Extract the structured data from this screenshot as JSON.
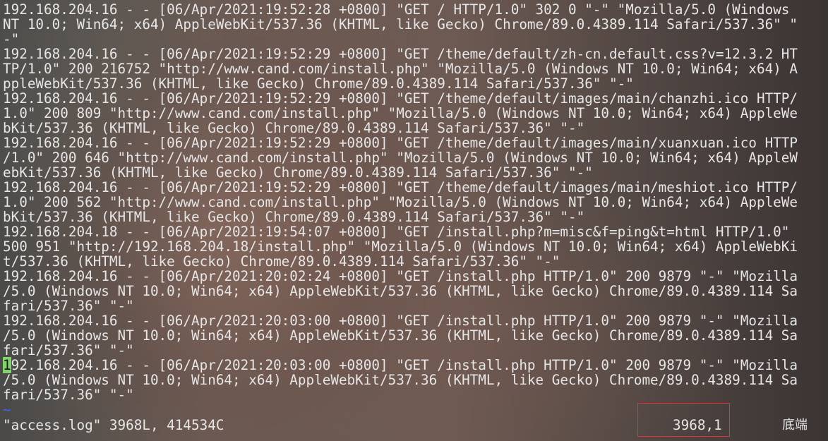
{
  "log": {
    "lines": [
      "192.168.204.16 - - [06/Apr/2021:19:52:28 +0800] \"GET / HTTP/1.0\" 302 0 \"-\" \"Mozilla/5.0 (Windows",
      "NT 10.0; Win64; x64) AppleWebKit/537.36 (KHTML, like Gecko) Chrome/89.0.4389.114 Safari/537.36\" \"",
      "-\"",
      "192.168.204.16 - - [06/Apr/2021:19:52:29 +0800] \"GET /theme/default/zh-cn.default.css?v=12.3.2 HT",
      "TP/1.0\" 200 216752 \"http://www.cand.com/install.php\" \"Mozilla/5.0 (Windows NT 10.0; Win64; x64) A",
      "ppleWebKit/537.36 (KHTML, like Gecko) Chrome/89.0.4389.114 Safari/537.36\" \"-\"",
      "192.168.204.16 - - [06/Apr/2021:19:52:29 +0800] \"GET /theme/default/images/main/chanzhi.ico HTTP/",
      "1.0\" 200 809 \"http://www.cand.com/install.php\" \"Mozilla/5.0 (Windows NT 10.0; Win64; x64) AppleWe",
      "bKit/537.36 (KHTML, like Gecko) Chrome/89.0.4389.114 Safari/537.36\" \"-\"",
      "192.168.204.16 - - [06/Apr/2021:19:52:29 +0800] \"GET /theme/default/images/main/xuanxuan.ico HTTP",
      "/1.0\" 200 646 \"http://www.cand.com/install.php\" \"Mozilla/5.0 (Windows NT 10.0; Win64; x64) AppleW",
      "ebKit/537.36 (KHTML, like Gecko) Chrome/89.0.4389.114 Safari/537.36\" \"-\"",
      "192.168.204.16 - - [06/Apr/2021:19:52:29 +0800] \"GET /theme/default/images/main/meshiot.ico HTTP/",
      "1.0\" 200 562 \"http://www.cand.com/install.php\" \"Mozilla/5.0 (Windows NT 10.0; Win64; x64) AppleWe",
      "bKit/537.36 (KHTML, like Gecko) Chrome/89.0.4389.114 Safari/537.36\" \"-\"",
      "192.168.204.18 - - [06/Apr/2021:19:54:07 +0800] \"GET /install.php?m=misc&f=ping&t=html HTTP/1.0\"",
      "500 951 \"http://192.168.204.18/install.php\" \"Mozilla/5.0 (Windows NT 10.0; Win64; x64) AppleWebKi",
      "t/537.36 (KHTML, like Gecko) Chrome/89.0.4389.114 Safari/537.36\" \"-\"",
      "192.168.204.16 - - [06/Apr/2021:20:02:24 +0800] \"GET /install.php HTTP/1.0\" 200 9879 \"-\" \"Mozilla",
      "/5.0 (Windows NT 10.0; Win64; x64) AppleWebKit/537.36 (KHTML, like Gecko) Chrome/89.0.4389.114 Sa",
      "fari/537.36\" \"-\"",
      "192.168.204.16 - - [06/Apr/2021:20:03:00 +0800] \"GET /install.php HTTP/1.0\" 200 9879 \"-\" \"Mozilla",
      "/5.0 (Windows NT 10.0; Win64; x64) AppleWebKit/537.36 (KHTML, like Gecko) Chrome/89.0.4389.114 Sa",
      "fari/537.36\" \"-\""
    ],
    "cursor_line": {
      "cursor_char": "1",
      "rest": "92.168.204.16 - - [06/Apr/2021:20:03:00 +0800] \"GET /install.php HTTP/1.0\" 200 9879 \"-\" \"Mozilla"
    },
    "tail_lines": [
      "/5.0 (Windows NT 10.0; Win64; x64) AppleWebKit/537.36 (KHTML, like Gecko) Chrome/89.0.4389.114 Sa",
      "fari/537.36\" \"-\""
    ],
    "empty_marker": "~"
  },
  "status": {
    "file_info": "\"access.log\" 3968L, 414534C",
    "ruler": "3968,1",
    "position": "底端"
  },
  "colors": {
    "text": "#e6e6e6",
    "cursor_bg": "#7fd46b",
    "tilde": "#3a64ff",
    "highlight_box": "#e0343a"
  }
}
